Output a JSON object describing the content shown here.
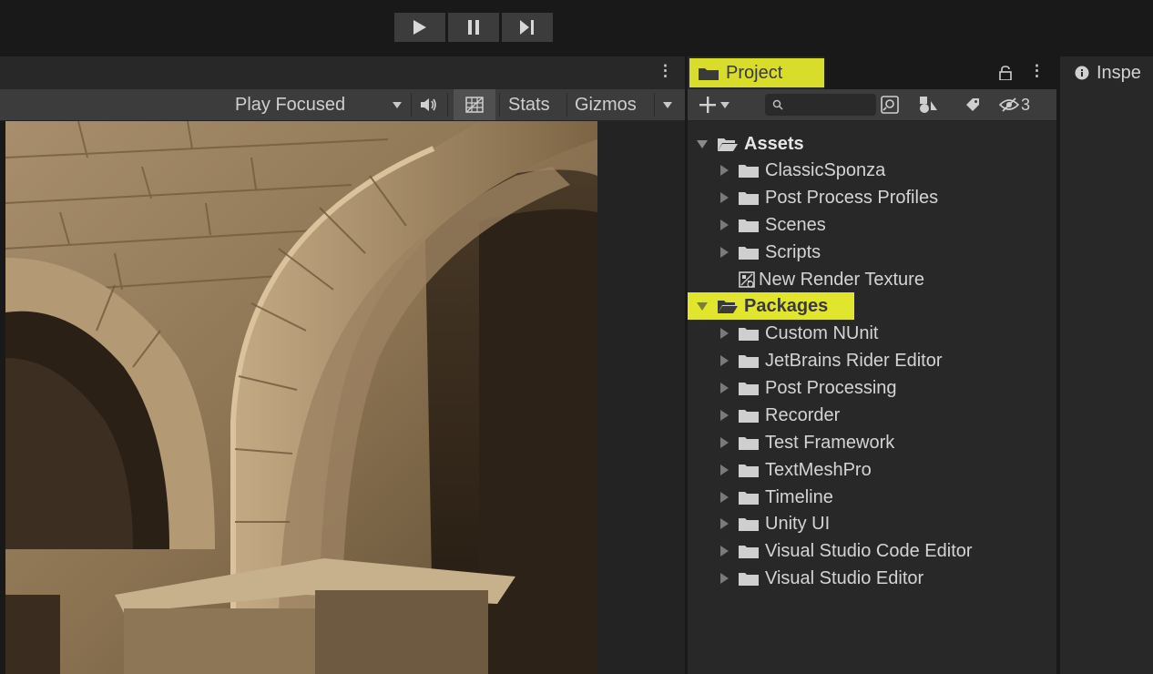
{
  "toolbar": {
    "play_icon": "play-icon",
    "pause_icon": "pause-icon",
    "step_icon": "step-icon"
  },
  "game": {
    "play_mode": "Play Focused",
    "stats_label": "Stats",
    "gizmos_label": "Gizmos"
  },
  "project": {
    "tab_label": "Project",
    "lock_icon": "lock-icon",
    "hidden_count": "3",
    "tree": {
      "assets_label": "Assets",
      "assets_children": [
        "ClassicSponza",
        "Post Process Profiles",
        "Scenes",
        "Scripts"
      ],
      "render_texture_label": "New Render Texture",
      "packages_label": "Packages",
      "packages_children": [
        "Custom NUnit",
        "JetBrains Rider Editor",
        "Post Processing",
        "Recorder",
        "Test Framework",
        "TextMeshPro",
        "Timeline",
        "Unity UI",
        "Visual Studio Code Editor",
        "Visual Studio Editor"
      ]
    }
  },
  "inspector": {
    "tab_label": "Inspe"
  },
  "colors": {
    "highlight": "#e7ec2a",
    "panel_bg": "#282828",
    "toolbar_bg": "#3c3c3c"
  }
}
